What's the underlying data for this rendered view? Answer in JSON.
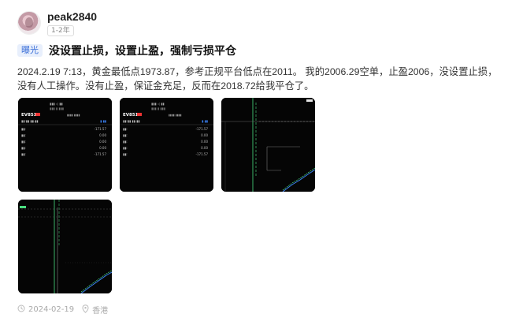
{
  "user": {
    "name": "peak2840",
    "tenure": "1-2年"
  },
  "post": {
    "tag": "曝光",
    "title": "没设置止损，设置止盈，强制亏损平仓",
    "body_line1": "2024.2.19 7:13，黄金最低点1973.87，参考正规平台低点在2011。 我的2006.29空单，止盈2006，没设置止损，",
    "body_line2": "没有人工操作。没有止盈，保证金充足，反而在2018.72给我平仓了。"
  },
  "thumbs": [
    {
      "symbol": "EV851",
      "row_b": "-171.57",
      "row_c": "0.00",
      "row_d": "0.00",
      "row_e": "0.00",
      "row_f": "-171.57"
    },
    {
      "symbol": "EV851",
      "row_b": "-171.57",
      "row_c": "0.00",
      "row_d": "0.00",
      "row_e": "0.00",
      "row_f": "-171.57"
    }
  ],
  "footer": {
    "date": "2024-02-19",
    "location": "香港"
  },
  "colors": {
    "tag_text": "#3b6fd8",
    "tag_bg": "#e8effc",
    "thumb_bg": "#050505"
  }
}
